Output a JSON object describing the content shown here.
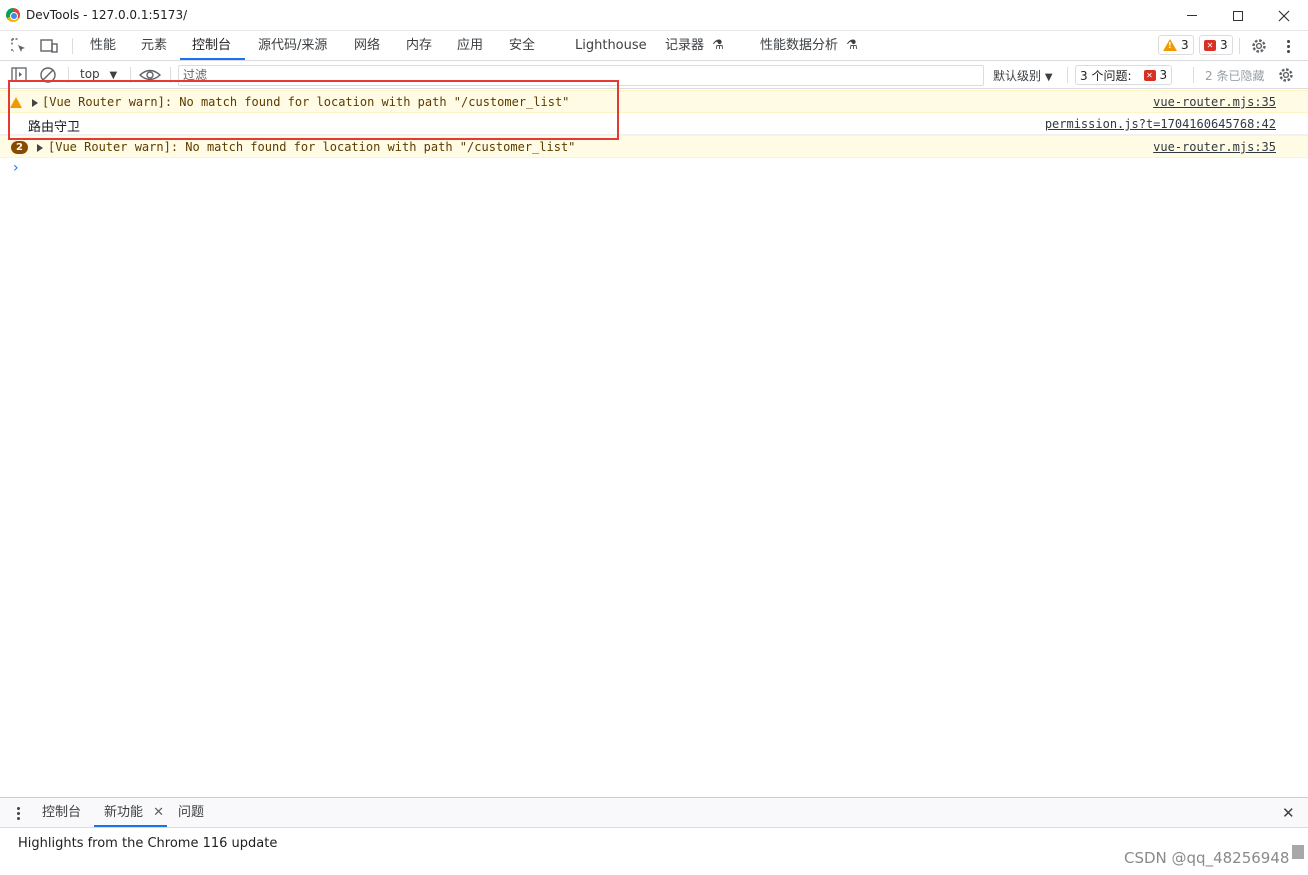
{
  "window": {
    "title": "DevTools - 127.0.0.1:5173/",
    "icon": "chrome-icon"
  },
  "tabs": [
    {
      "label": "性能"
    },
    {
      "label": "元素"
    },
    {
      "label": "控制台",
      "active": true
    },
    {
      "label": "源代码/来源"
    },
    {
      "label": "网络"
    },
    {
      "label": "内存"
    },
    {
      "label": "应用"
    },
    {
      "label": "安全"
    },
    {
      "label": "Lighthouse"
    },
    {
      "label": "记录器"
    },
    {
      "label": "性能数据分析"
    }
  ],
  "counters": {
    "warnings": "3",
    "errors": "3"
  },
  "toolbar": {
    "context": "top",
    "filter_placeholder": "过滤",
    "levels": "默认级别",
    "issues_label": "3 个问题:",
    "issues_count": "3",
    "hidden": "2 条已隐藏"
  },
  "console": {
    "rows": [
      {
        "type": "warning",
        "text": "[Vue Router warn]: No match found for location with path \"/customer_list\"",
        "source": "vue-router.mjs:35"
      },
      {
        "type": "log",
        "text": "路由守卫",
        "source": "permission.js?t=1704160645768:42"
      },
      {
        "type": "warning",
        "count": "2",
        "text": "[Vue Router warn]: No match found for location with path \"/customer_list\"",
        "source": "vue-router.mjs:35"
      }
    ]
  },
  "drawer": {
    "tabs": [
      {
        "label": "控制台"
      },
      {
        "label": "新功能",
        "active": true
      },
      {
        "label": "问题"
      }
    ],
    "content": "Highlights from the Chrome 116 update"
  },
  "watermark": "CSDN @qq_48256948",
  "colors": {
    "accent": "#1a73e8",
    "warning_bg": "#fffbe5",
    "highlight_box": "#e53935"
  }
}
